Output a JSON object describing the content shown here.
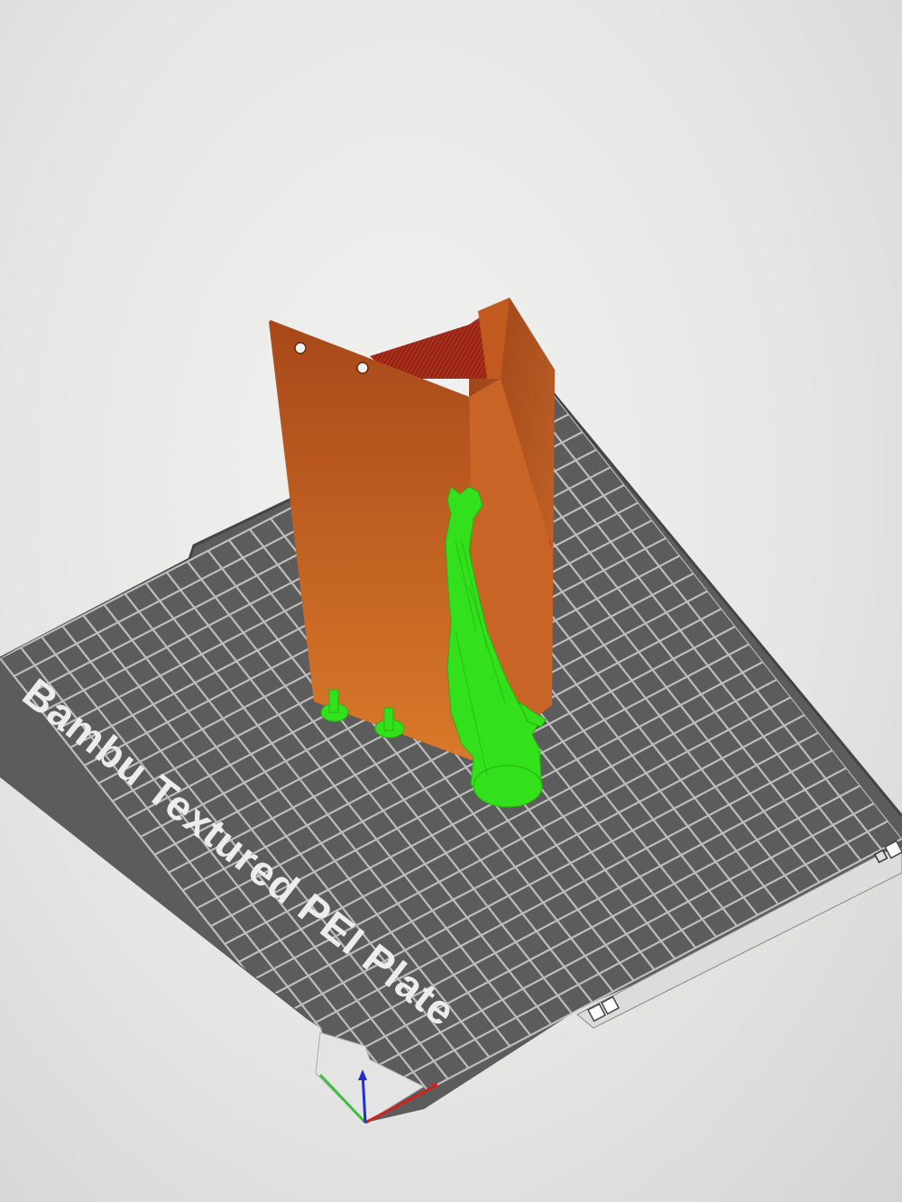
{
  "plate": {
    "label": "Bambu Textured PEI Plate",
    "plate_color": "#5c5c5c",
    "grid_color": "#cfcfcf"
  },
  "model": {
    "part_color": "#b5521d",
    "support_color": "#33e01c",
    "overhang_color": "#c81e1e"
  },
  "axes": {
    "x_color": "#d41f1f",
    "y_color": "#3dbf3d",
    "z_color": "#1f2fd4"
  },
  "toolbar_icons": [
    "lock-icon",
    "grid-icon"
  ]
}
